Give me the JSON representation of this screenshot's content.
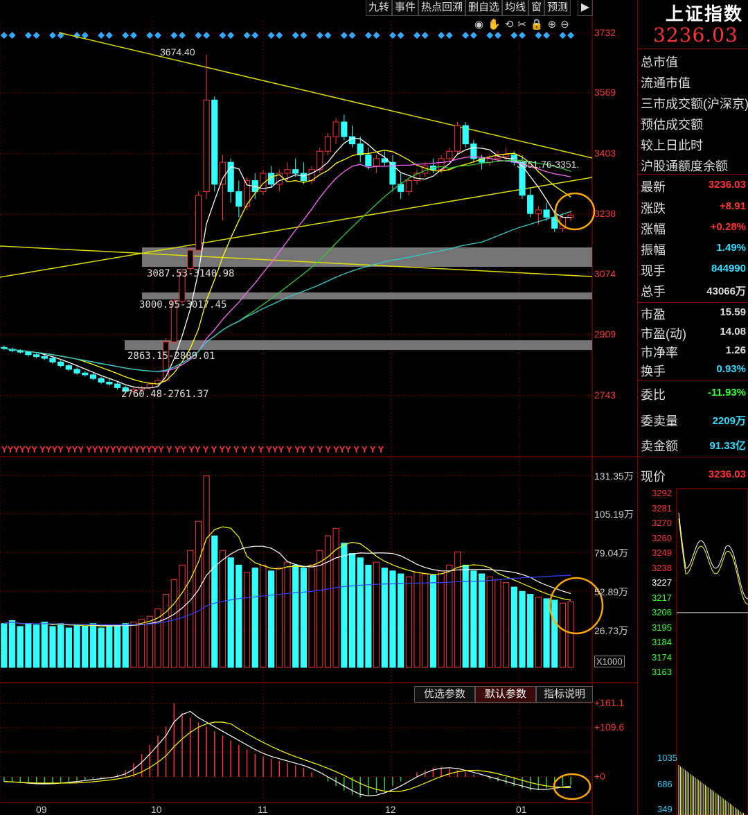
{
  "toolbar": [
    {
      "name": "jiuzhuan",
      "label": "九转"
    },
    {
      "name": "shijian",
      "label": "事件"
    },
    {
      "name": "redian",
      "label": "热点回溯"
    },
    {
      "name": "shanzixuan",
      "label": "删自选"
    },
    {
      "name": "junxian",
      "label": "均线"
    },
    {
      "name": "chuang",
      "label": "窗"
    },
    {
      "name": "yuce",
      "label": "预测"
    }
  ],
  "right_panel": {
    "title": "上证指数",
    "price": "3236.03",
    "labels": [
      "总市值",
      "流通市值",
      "三市成交额(沪深京)",
      "预估成交额",
      "较上日此时",
      "沪股通额度余额"
    ],
    "stats": [
      {
        "label": "最新",
        "value": "3236.03",
        "color": "#ff3333"
      },
      {
        "label": "涨跌",
        "value": "+8.91",
        "color": "#ff3333"
      },
      {
        "label": "涨幅",
        "value": "+0.28%",
        "color": "#ff3333"
      },
      {
        "label": "振幅",
        "value": "1.49%",
        "color": "#33ddff"
      },
      {
        "label": "现手",
        "value": "844990",
        "color": "#33ddff"
      },
      {
        "label": "总手",
        "value": "43066万",
        "color": "#dddddd"
      },
      {
        "label": "市盈",
        "value": "15.59",
        "color": "#dddddd"
      },
      {
        "label": "市盈(动)",
        "value": "14.08",
        "color": "#dddddd"
      },
      {
        "label": "市净率",
        "value": "1.26",
        "color": "#dddddd"
      },
      {
        "label": "换手",
        "value": "0.93%",
        "color": "#33ddff"
      },
      {
        "label": "委比",
        "value": "-11.93%",
        "color": "#33ff33"
      },
      {
        "label": "委卖量",
        "value": "2209万",
        "color": "#33ddff"
      },
      {
        "label": "卖金额",
        "value": "91.33亿",
        "color": "#33ddff"
      }
    ],
    "intraday_label": "现价",
    "intraday_price": "3236.03",
    "intraday_ticks": [
      "3292",
      "3281",
      "3270",
      "3260",
      "3249",
      "3238",
      "3227",
      "3217",
      "3206",
      "3195",
      "3184",
      "3174",
      "3163"
    ],
    "volume_ticks": [
      "1035",
      "686",
      "349"
    ]
  },
  "main_ticks": [
    "3732",
    "3569",
    "3403",
    "3238",
    "3074",
    "2909",
    "2743"
  ],
  "volume_ticks": [
    "131.35万",
    "105.19万",
    "79.04万",
    "52.89万",
    "26.73万"
  ],
  "volume_unit": "X1000",
  "macd_ticks": [
    "+161.1",
    "+109.6",
    "+0"
  ],
  "months": [
    "09",
    "10",
    "11",
    "12",
    "01"
  ],
  "annotations": {
    "high": "3674.40",
    "box1": "3351.76-3351.",
    "gap1": "3087.53-3140.98",
    "gap2": "3000.95-3017.45",
    "gap3": "2863.15-2889.01",
    "gap4": "2760.48-2761.37"
  },
  "indicator_buttons": [
    "优选参数",
    "默认参数",
    "指标说明"
  ],
  "colors": {
    "up": "#ff3333",
    "down": "#33ffff",
    "ma5": "#ffffff",
    "ma10": "#ffff00",
    "ma20": "#ff66ff",
    "ma30": "#33cc33",
    "ma60": "#33cccc",
    "grid": "#800000"
  },
  "chart_data": {
    "type": "candlestick",
    "ylim": [
      2743,
      3732
    ],
    "candles": [
      [
        2875,
        2880,
        2868,
        2872
      ],
      [
        2870,
        2874,
        2862,
        2866
      ],
      [
        2866,
        2870,
        2858,
        2862
      ],
      [
        2862,
        2866,
        2850,
        2855
      ],
      [
        2855,
        2860,
        2845,
        2850
      ],
      [
        2850,
        2858,
        2840,
        2845
      ],
      [
        2845,
        2850,
        2830,
        2835
      ],
      [
        2835,
        2840,
        2820,
        2825
      ],
      [
        2825,
        2830,
        2810,
        2815
      ],
      [
        2815,
        2820,
        2800,
        2805
      ],
      [
        2805,
        2810,
        2795,
        2800
      ],
      [
        2800,
        2805,
        2785,
        2790
      ],
      [
        2790,
        2795,
        2775,
        2780
      ],
      [
        2780,
        2790,
        2770,
        2775
      ],
      [
        2775,
        2780,
        2760,
        2765
      ],
      [
        2765,
        2770,
        2750,
        2755
      ],
      [
        2755,
        2765,
        2745,
        2760
      ],
      [
        2760,
        2770,
        2752,
        2765
      ],
      [
        2765,
        2780,
        2760,
        2775
      ],
      [
        2775,
        2790,
        2770,
        2785
      ],
      [
        2785,
        2900,
        2780,
        2890
      ],
      [
        2890,
        3010,
        2885,
        3000
      ],
      [
        3000,
        3090,
        2995,
        3080
      ],
      [
        3090,
        3150,
        3080,
        3140
      ],
      [
        3140,
        3300,
        3130,
        3290
      ],
      [
        3300,
        3674,
        3280,
        3550
      ],
      [
        3550,
        3560,
        3300,
        3320
      ],
      [
        3320,
        3400,
        3220,
        3380
      ],
      [
        3380,
        3390,
        3270,
        3300
      ],
      [
        3300,
        3330,
        3230,
        3260
      ],
      [
        3260,
        3340,
        3250,
        3330
      ],
      [
        3330,
        3350,
        3280,
        3300
      ],
      [
        3300,
        3360,
        3290,
        3350
      ],
      [
        3350,
        3370,
        3310,
        3320
      ],
      [
        3320,
        3360,
        3300,
        3350
      ],
      [
        3350,
        3380,
        3330,
        3360
      ],
      [
        3360,
        3390,
        3340,
        3350
      ],
      [
        3350,
        3380,
        3320,
        3330
      ],
      [
        3330,
        3370,
        3320,
        3360
      ],
      [
        3360,
        3420,
        3350,
        3410
      ],
      [
        3410,
        3460,
        3400,
        3450
      ],
      [
        3450,
        3500,
        3430,
        3490
      ],
      [
        3490,
        3510,
        3440,
        3450
      ],
      [
        3450,
        3480,
        3420,
        3430
      ],
      [
        3430,
        3450,
        3380,
        3400
      ],
      [
        3400,
        3420,
        3360,
        3370
      ],
      [
        3370,
        3400,
        3350,
        3390
      ],
      [
        3390,
        3410,
        3370,
        3380
      ],
      [
        3380,
        3400,
        3300,
        3320
      ],
      [
        3320,
        3350,
        3280,
        3300
      ],
      [
        3300,
        3340,
        3290,
        3330
      ],
      [
        3330,
        3360,
        3320,
        3350
      ],
      [
        3350,
        3380,
        3340,
        3370
      ],
      [
        3370,
        3390,
        3350,
        3360
      ],
      [
        3360,
        3400,
        3350,
        3390
      ],
      [
        3390,
        3420,
        3380,
        3410
      ],
      [
        3410,
        3490,
        3400,
        3480
      ],
      [
        3480,
        3490,
        3420,
        3430
      ],
      [
        3430,
        3440,
        3380,
        3390
      ],
      [
        3390,
        3400,
        3360,
        3380
      ],
      [
        3380,
        3400,
        3370,
        3390
      ],
      [
        3390,
        3410,
        3380,
        3395
      ],
      [
        3395,
        3420,
        3380,
        3400
      ],
      [
        3400,
        3410,
        3370,
        3380
      ],
      [
        3380,
        3400,
        3280,
        3290
      ],
      [
        3290,
        3310,
        3230,
        3240
      ],
      [
        3240,
        3260,
        3210,
        3250
      ],
      [
        3250,
        3270,
        3220,
        3230
      ],
      [
        3230,
        3250,
        3190,
        3200
      ],
      [
        3200,
        3240,
        3190,
        3230
      ],
      [
        3230,
        3250,
        3220,
        3236
      ]
    ],
    "volume": [
      30,
      32,
      28,
      30,
      29,
      31,
      28,
      30,
      27,
      29,
      28,
      30,
      27,
      28,
      29,
      30,
      31,
      33,
      35,
      40,
      50,
      60,
      70,
      80,
      100,
      131,
      90,
      80,
      75,
      70,
      65,
      68,
      70,
      66,
      68,
      72,
      70,
      68,
      70,
      80,
      90,
      95,
      85,
      78,
      75,
      70,
      72,
      68,
      66,
      64,
      62,
      65,
      64,
      63,
      66,
      70,
      79,
      70,
      66,
      64,
      62,
      60,
      58,
      55,
      52,
      50,
      48,
      47,
      46,
      44,
      45
    ],
    "macd": [
      -10,
      -12,
      -14,
      -15,
      -16,
      -15,
      -14,
      -12,
      -10,
      -8,
      -6,
      -4,
      -2,
      0,
      5,
      15,
      30,
      50,
      70,
      90,
      110,
      161,
      140,
      130,
      120,
      110,
      100,
      90,
      80,
      70,
      60,
      50,
      45,
      40,
      35,
      30,
      25,
      20,
      10,
      0,
      -10,
      -20,
      -30,
      -40,
      -45,
      -40,
      -35,
      -30,
      -20,
      -10,
      0,
      10,
      15,
      20,
      22,
      18,
      15,
      10,
      5,
      0,
      -5,
      -10,
      -15,
      -20,
      -25,
      -30,
      -28,
      -25,
      -22,
      -20,
      -18
    ]
  }
}
